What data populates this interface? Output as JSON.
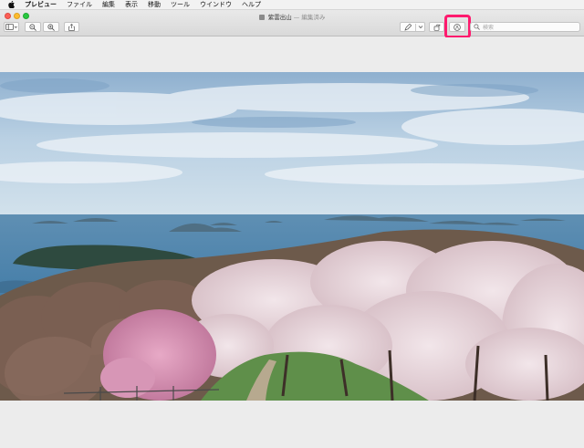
{
  "menubar": {
    "apple_icon": "apple-icon",
    "items": [
      "プレビュー",
      "ファイル",
      "編集",
      "表示",
      "移動",
      "ツール",
      "ウインドウ",
      "ヘルプ"
    ]
  },
  "window": {
    "title": "紫雲出山",
    "separator": "—",
    "status": "編集済み"
  },
  "toolbar": {
    "sidebar_icon": "sidebar-icon",
    "zoom_out_icon": "zoom-out-icon",
    "zoom_in_icon": "zoom-in-icon",
    "share_icon": "share-icon",
    "markup_pen_icon": "pen-icon",
    "rotate_icon": "rotate-icon",
    "markup_toolbar_icon": "markup-icon"
  },
  "search": {
    "placeholder": "検索"
  },
  "colors": {
    "highlight": "#ff1a6e",
    "close": "#fc5f57",
    "minimize": "#fdbc2e",
    "maximize": "#28c840"
  }
}
